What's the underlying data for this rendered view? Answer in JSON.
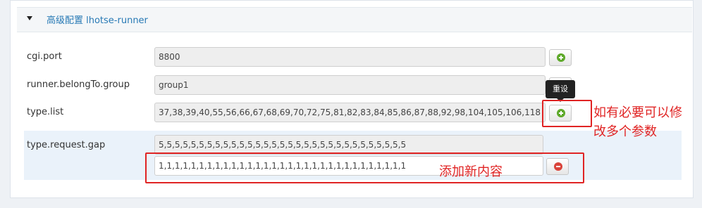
{
  "header": {
    "title": "高级配置 lhotse-runner"
  },
  "fields": [
    {
      "label": "cgi.port",
      "value": "8800"
    },
    {
      "label": "runner.belongTo.group",
      "value": "group1"
    },
    {
      "label": "type.list",
      "value": "37,38,39,40,55,56,66,67,68,69,70,72,75,81,82,83,84,85,86,87,88,92,98,104,105,106,118"
    },
    {
      "label": "type.request.gap",
      "value": "5,5,5,5,5,5,5,5,5,5,5,5,5,5,5,5,5,5,5,5,5,5,5,5,5,5,5,5,5,5,5"
    }
  ],
  "new_entry": {
    "value": "1,1,1,1,1,1,1,1,1,1,1,1,1,1,1,1,1,1,1,1,1,1,1,1,1,1,1,1,1,1,1"
  },
  "tooltip": {
    "text": "重设"
  },
  "annotations": {
    "modify_note_line1": "如有必要可以修",
    "modify_note_line2": "改多个参数",
    "add_note": "添加新内容"
  },
  "colors": {
    "accent_link": "#2779b5",
    "add_icon": "#5ea92a",
    "remove_icon": "#d9433a",
    "annotation": "#e02424"
  },
  "icons": {
    "add": "plus-circle-icon",
    "remove": "minus-circle-icon",
    "collapse": "caret-down-icon"
  }
}
